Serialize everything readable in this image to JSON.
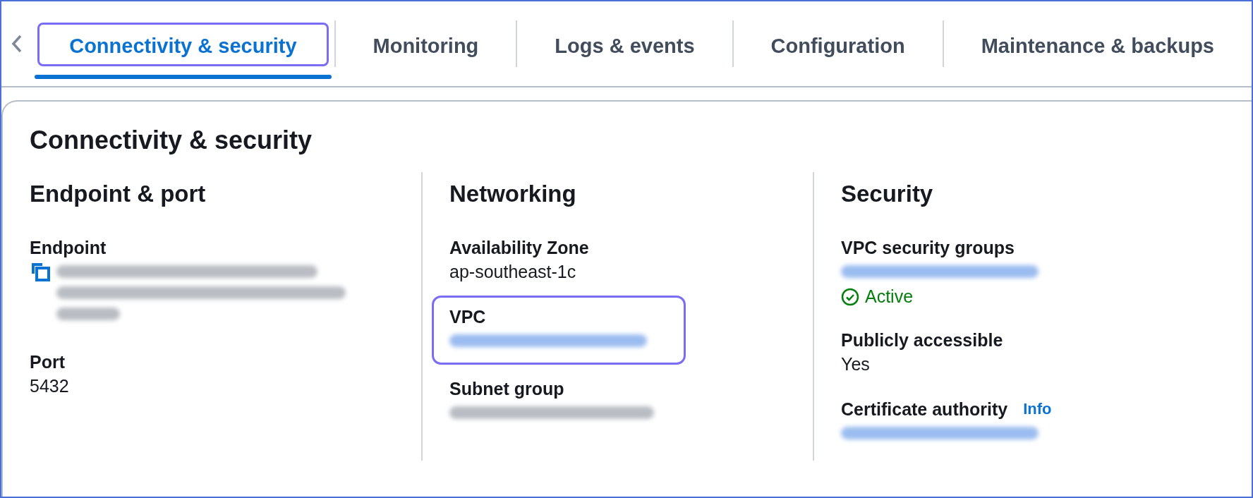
{
  "tabs": [
    {
      "label": "Connectivity & security",
      "selected": true,
      "highlighted": true
    },
    {
      "label": "Monitoring",
      "selected": false,
      "highlighted": false
    },
    {
      "label": "Logs & events",
      "selected": false,
      "highlighted": false
    },
    {
      "label": "Configuration",
      "selected": false,
      "highlighted": false
    },
    {
      "label": "Maintenance & backups",
      "selected": false,
      "highlighted": false
    }
  ],
  "panel": {
    "title": "Connectivity & security",
    "columns": [
      {
        "title": "Endpoint & port",
        "fields": [
          {
            "label": "Endpoint",
            "kind": "redacted-multiline",
            "copy_button": true
          },
          {
            "label": "Port",
            "kind": "text",
            "value": "5432"
          }
        ]
      },
      {
        "title": "Networking",
        "fields": [
          {
            "label": "Availability Zone",
            "kind": "text",
            "value": "ap-southeast-1c"
          },
          {
            "label": "VPC",
            "kind": "redacted-link",
            "highlighted": true
          },
          {
            "label": "Subnet group",
            "kind": "redacted"
          }
        ]
      },
      {
        "title": "Security",
        "fields": [
          {
            "label": "VPC security groups",
            "kind": "redacted-link",
            "status": "Active"
          },
          {
            "label": "Publicly accessible",
            "kind": "text",
            "value": "Yes"
          },
          {
            "label": "Certificate authority",
            "kind": "redacted-link",
            "info": "Info"
          }
        ]
      }
    ]
  }
}
